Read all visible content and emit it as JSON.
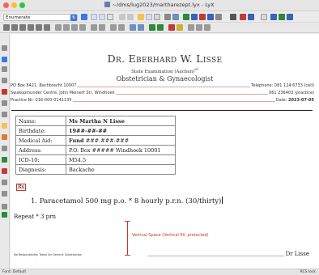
{
  "window": {
    "title": "~/dms/lug2023/martharezept.lyx - LyX"
  },
  "toolbar": {
    "paragraph_style": "Enumerate"
  },
  "letterhead": {
    "name": "Dr. Eberhard W. Lisse",
    "qualification": "State Examination (Aachen)",
    "specialty": "Obstetrician & Gynaecologist"
  },
  "address": {
    "line1_left": "PO Box 8421, Bachbrecht 10007",
    "line1_right": "Telephone: 081 124 6733 (cell)",
    "line2_left": "Swakopmunder Centre, John Meinert Str, Windhoek",
    "line2_right": "061 236403 (practice)",
    "line3_left": "Practice Nr: 016-000-0141135",
    "line3_right_label": "Date: ",
    "line3_right_value": "2023-07-05"
  },
  "patient_table": {
    "rows": [
      {
        "label": "Name:",
        "value": "Ms Martha N Lisse",
        "bold": true
      },
      {
        "label": "Birthdate:",
        "value": "19##-##-##",
        "bold": true
      },
      {
        "label": "Medical Aid:",
        "value_bold": "Fund ",
        "value": "###-###-###"
      },
      {
        "label": "Address:",
        "value": "P.O. Box ##### Windhoek 10001"
      },
      {
        "label": "ICD-10:",
        "value": "M54.5"
      },
      {
        "label": "Diagnosis:",
        "value": "Backache"
      }
    ]
  },
  "rx_label": "Rx",
  "prescription": {
    "item_number": "1.",
    "item_text": "Paracetamol 500 mg p.o. * 8 hourly p.r.n. (30/thirty)",
    "repeat": "Repeat * 3 prn"
  },
  "vertical_space_label": "Vertical Space (Vertical fill, protected)",
  "footer": {
    "responsibility_note": "No Responsibility Taken for Generic Substitution",
    "signature": "Dr Lisse"
  },
  "status": {
    "left": "Font: Default",
    "right": "RCS lock"
  },
  "colors": {
    "accent": "#3b78e7",
    "marker_red": "#c0392b"
  }
}
